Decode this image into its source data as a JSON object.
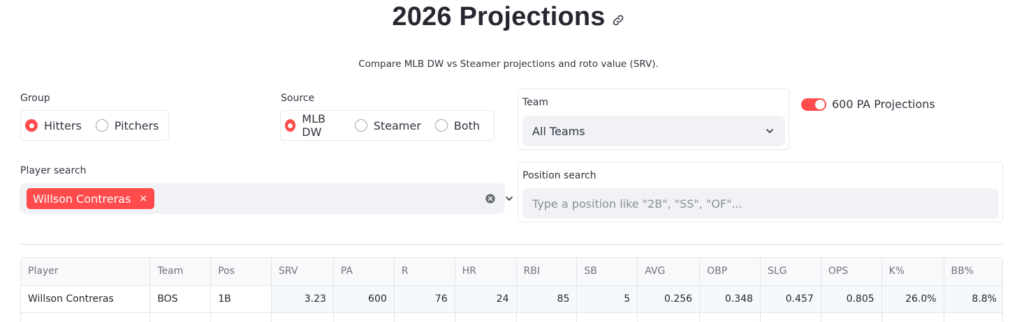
{
  "title": "2026 Projections",
  "subtitle": "Compare MLB DW vs Steamer projections and roto value (SRV).",
  "group": {
    "label": "Group",
    "options": [
      "Hitters",
      "Pitchers"
    ],
    "selected": "Hitters"
  },
  "source": {
    "label": "Source",
    "options": [
      "MLB DW",
      "Steamer",
      "Both"
    ],
    "selected": "MLB DW"
  },
  "team": {
    "label": "Team",
    "value": "All Teams"
  },
  "toggle": {
    "label": "600 PA Projections",
    "on": true
  },
  "player_search": {
    "label": "Player search",
    "chips": [
      "Willson Contreras"
    ],
    "chip_remove": "×"
  },
  "position_search": {
    "label": "Position search",
    "placeholder": "Type a position like \"2B\", \"SS\", \"OF\"..."
  },
  "table": {
    "columns": [
      "Player",
      "Team",
      "Pos",
      "SRV",
      "PA",
      "R",
      "HR",
      "RBI",
      "SB",
      "AVG",
      "OBP",
      "SLG",
      "OPS",
      "K%",
      "BB%"
    ],
    "rows": [
      [
        "Willson Contreras",
        "BOS",
        "1B",
        "3.23",
        "600",
        "76",
        "24",
        "85",
        "5",
        "0.256",
        "0.348",
        "0.457",
        "0.805",
        "26.0%",
        "8.8%"
      ]
    ]
  },
  "colors": {
    "accent": "#ff4b4b",
    "input_bg": "#f0f2f6",
    "text": "#31333f"
  }
}
